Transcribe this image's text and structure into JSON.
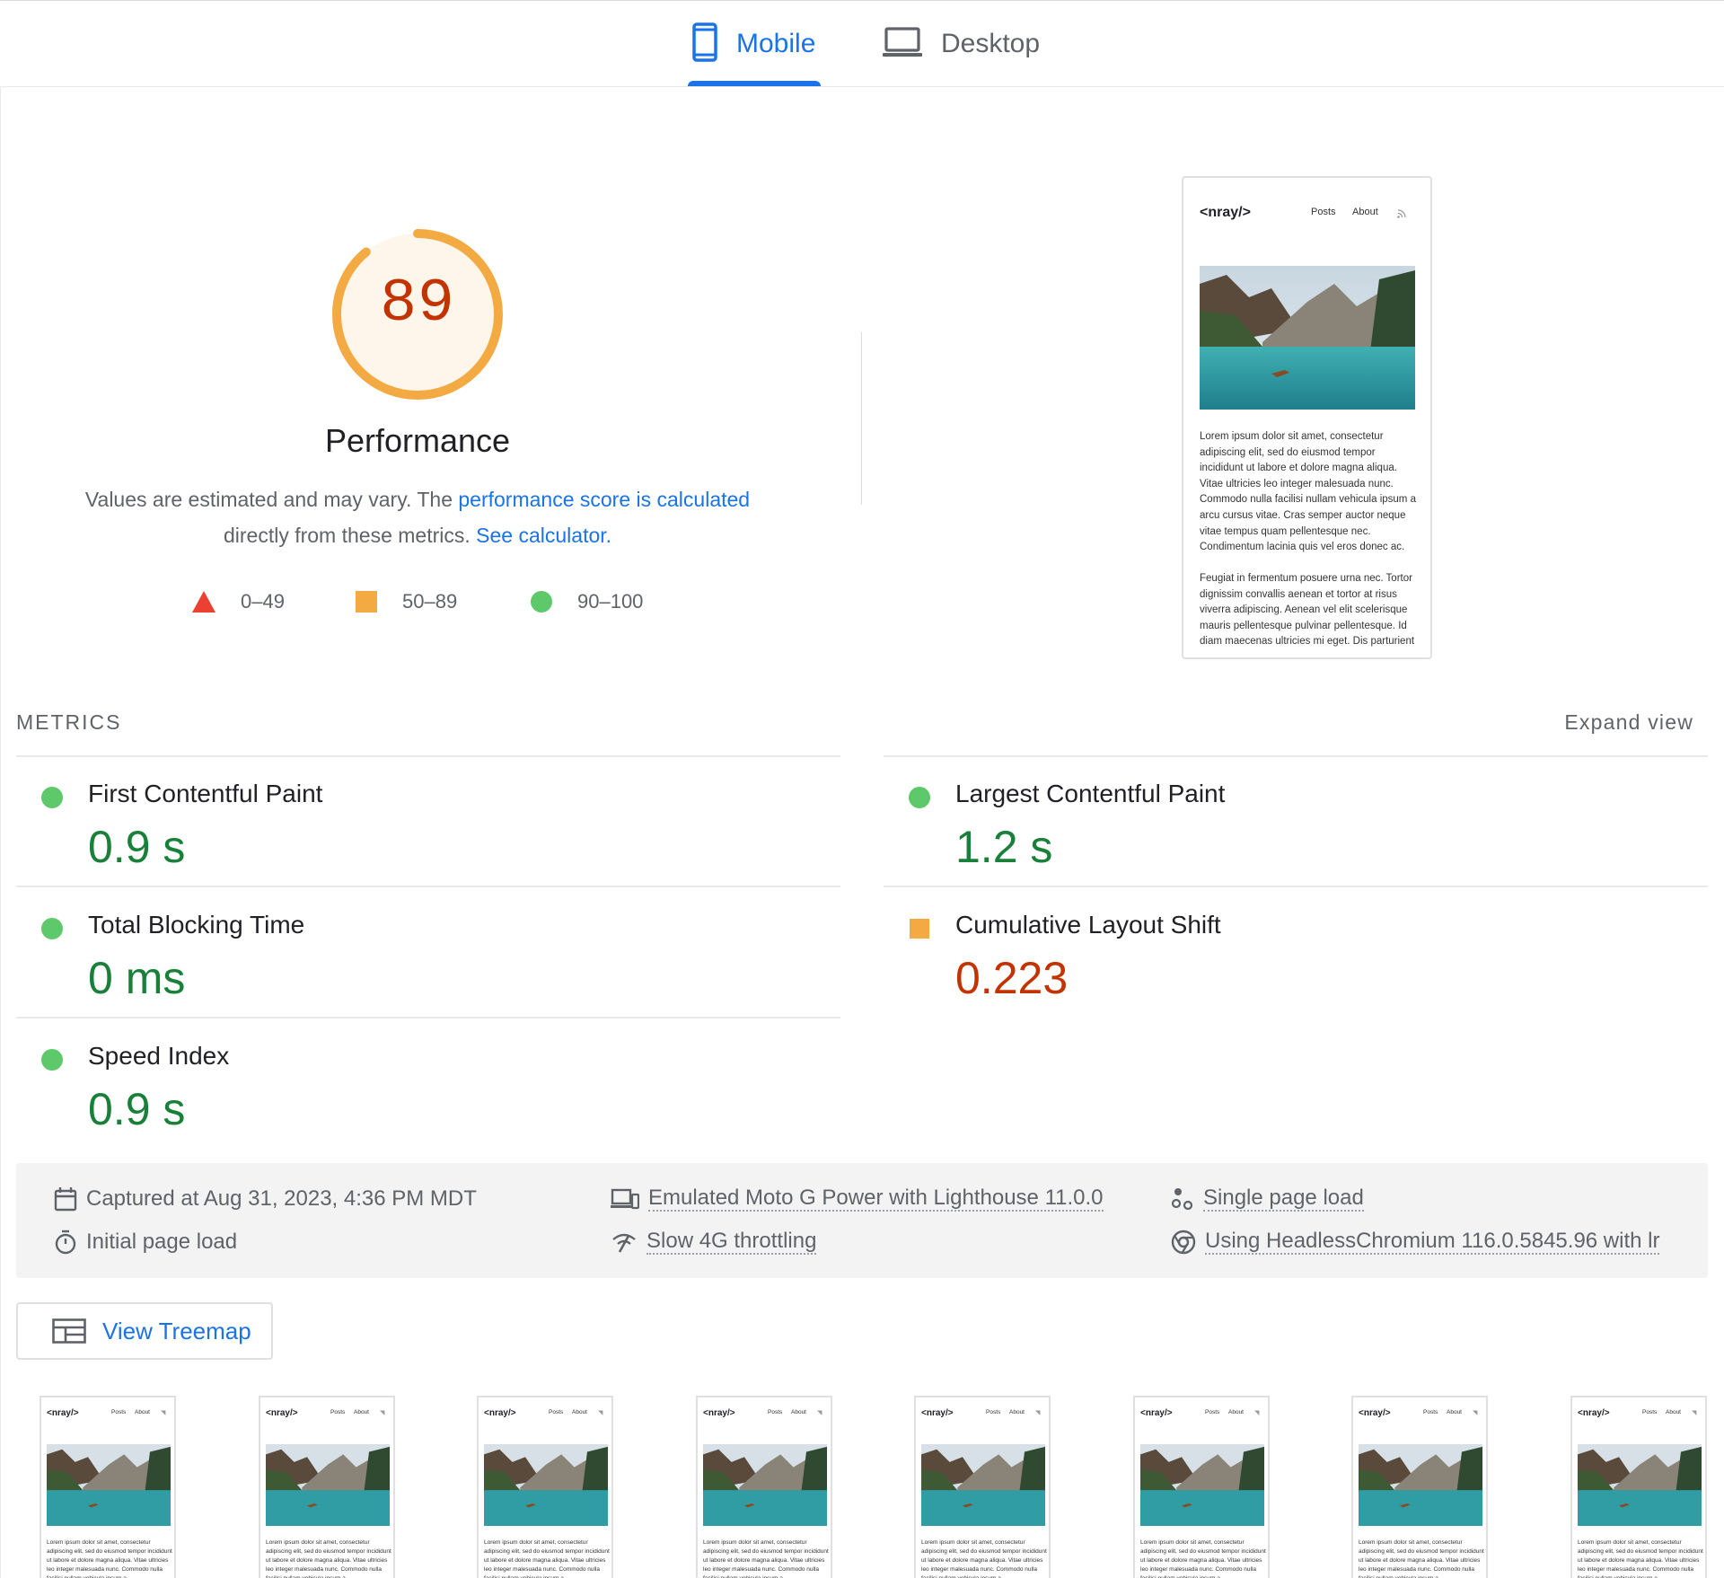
{
  "tabs": [
    {
      "label": "Mobile",
      "selected": true
    },
    {
      "label": "Desktop",
      "selected": false
    }
  ],
  "score": {
    "value": "89",
    "fraction": 0.89,
    "title": "Performance",
    "desc_prefix": "Values are estimated and may vary. The ",
    "desc_link1": "performance score is calculated",
    "desc_middle": "directly from these metrics. ",
    "desc_link2": "See calculator."
  },
  "legend": [
    {
      "range": "0–49",
      "shape": "triangle",
      "color": "#eb4133"
    },
    {
      "range": "50–89",
      "shape": "square",
      "color": "#f4aa43"
    },
    {
      "range": "90–100",
      "shape": "circle",
      "color": "#5ec96b"
    }
  ],
  "screenshot": {
    "logo": "<nray/>",
    "nav": [
      "Posts",
      "About"
    ],
    "rss_icon": "rss-icon",
    "paragraph1": "Lorem ipsum dolor sit amet, consectetur adipiscing elit, sed do eiusmod tempor incididunt ut labore et dolore magna aliqua. Vitae ultricies leo integer malesuada nunc. Commodo nulla facilisi nullam vehicula ipsum a arcu cursus vitae. Cras semper auctor neque vitae tempus quam pellentesque nec. Condimentum lacinia quis vel eros donec ac.",
    "paragraph2": "Feugiat in fermentum posuere urna nec. Tortor dignissim convallis aenean et tortor at risus viverra adipiscing. Aenean vel elit scelerisque mauris pellentesque pulvinar pellentesque. Id diam maecenas ultricies mi eget. Dis parturient"
  },
  "metrics": {
    "title": "METRICS",
    "expand": "Expand view",
    "items": [
      {
        "name": "First Contentful Paint",
        "value": "0.9 s",
        "rating": "pass"
      },
      {
        "name": "Largest Contentful Paint",
        "value": "1.2 s",
        "rating": "pass"
      },
      {
        "name": "Total Blocking Time",
        "value": "0 ms",
        "rating": "pass"
      },
      {
        "name": "Cumulative Layout Shift",
        "value": "0.223",
        "rating": "average"
      },
      {
        "name": "Speed Index",
        "value": "0.9 s",
        "rating": "pass"
      }
    ]
  },
  "runtime": {
    "captured": "Captured at Aug 31, 2023, 4:36 PM MDT",
    "initial_load": "Initial page load",
    "emulated": "Emulated Moto G Power with Lighthouse 11.0.0",
    "throttling": "Slow 4G throttling",
    "single_page": "Single page load",
    "browser": "Using HeadlessChromium 116.0.5845.96 with lr"
  },
  "treemap": {
    "label": "View Treemap"
  },
  "filmstrip": {
    "frame_count": 8,
    "logo": "<nray/>",
    "nav": [
      "Posts",
      "About"
    ],
    "text": "Lorem ipsum dolor sit amet, consectetur adipiscing elit, sed do eiusmod tempor incididunt ut labore et dolore magna aliqua. Vitae ultricies leo integer malesuada nunc. Commodo nulla facilisi nullam vehicula ipsum a"
  },
  "colors": {
    "accent": "#1a73e8",
    "pass": "#188038",
    "average": "#c33300",
    "gauge_arc": "#f4aa43",
    "gauge_bg": "#fef6ea"
  }
}
